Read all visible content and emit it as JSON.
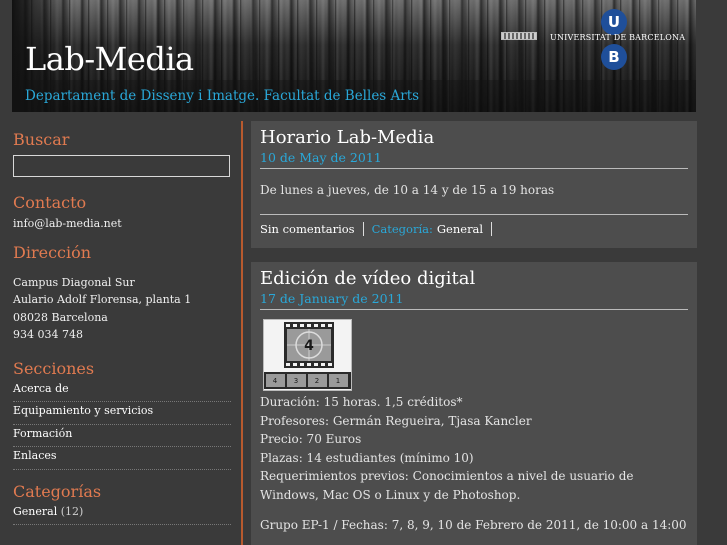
{
  "header": {
    "title": "Lab-Media",
    "subtitle": "Departament de Disseny i Imatge. Facultat de Belles Arts",
    "university": "UNIVERSITAT DE BARCELONA",
    "logo_u": "U",
    "logo_b": "B"
  },
  "sidebar": {
    "search_heading": "Buscar",
    "contact_heading": "Contacto",
    "contact_email": "info@lab-media.net",
    "address_heading": "Dirección",
    "address_lines": [
      "Campus Diagonal Sur",
      "Aulario Adolf Florensa, planta 1",
      "08028 Barcelona",
      "934 034 748"
    ],
    "sections_heading": "Secciones",
    "sections": [
      "Acerca de",
      "Equipamiento y servicios",
      "Formación",
      "Enlaces"
    ],
    "categories_heading": "Categorías",
    "categories": [
      {
        "name": "General",
        "count": "(12)"
      }
    ]
  },
  "posts": [
    {
      "title": "Horario Lab-Media",
      "date": "10 de May de 2011",
      "body": "De lunes a jueves, de 10 a 14 y de 15 a 19 horas",
      "comments": "Sin comentarios",
      "category_label": "Categoría:",
      "category": "General"
    },
    {
      "title": "Edición de vídeo digital",
      "date": "17 de January de 2011",
      "image_numbers": [
        "4",
        "3",
        "2",
        "1"
      ],
      "big_number": "4",
      "lines": [
        "Duración: 15 horas. 1,5 créditos*",
        "Profesores: Germán Regueira, Tjasa Kancler",
        "Precio: 70 Euros",
        "Plazas: 14 estudiantes (mínimo 10)",
        "Requerimientos previos: Conocimientos a nivel de usuario de Windows, Mac OS o Linux y de Photoshop."
      ],
      "group": "Grupo EP-1 / Fechas: 7, 8, 9, 10 de Febrero de 2011, de 10:00 a 14:00"
    }
  ]
}
